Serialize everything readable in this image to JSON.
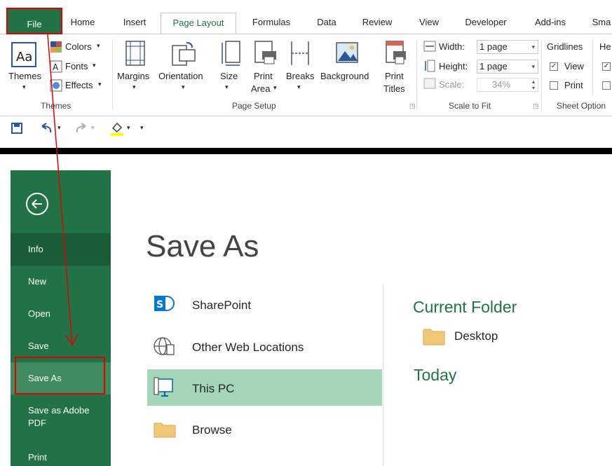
{
  "ribbon_tabs": {
    "file": "File",
    "items": [
      "Home",
      "Insert",
      "Page Layout",
      "Formulas",
      "Data",
      "Review",
      "View",
      "Developer",
      "Add-ins",
      "Sma"
    ],
    "active": "Page Layout"
  },
  "themes_group": {
    "themes_label": "Themes",
    "colors_label": "Colors",
    "fonts_label": "Fonts",
    "effects_label": "Effects",
    "group_label": "Themes"
  },
  "page_setup_group": {
    "margins": "Margins",
    "orientation": "Orientation",
    "size": "Size",
    "print_area_1": "Print",
    "print_area_2": "Area",
    "breaks": "Breaks",
    "background": "Background",
    "print_titles_1": "Print",
    "print_titles_2": "Titles",
    "group_label": "Page Setup"
  },
  "scale_group": {
    "width_label": "Width:",
    "width_value": "1 page",
    "height_label": "Height:",
    "height_value": "1 page",
    "scale_label": "Scale:",
    "scale_value": "34%",
    "group_label": "Scale to Fit"
  },
  "sheet_options_group": {
    "gridlines": "Gridlines",
    "headings": "He",
    "view": "View",
    "view_checked": true,
    "print": "Print",
    "print_checked": false,
    "group_label": "Sheet Option"
  },
  "backstage": {
    "nav": [
      "Info",
      "New",
      "Open",
      "Save",
      "Save As",
      "Save as Adobe PDF",
      "Print"
    ],
    "selected_nav": "Save As",
    "title": "Save As",
    "locations": [
      "SharePoint",
      "Other Web Locations",
      "This PC",
      "Browse"
    ],
    "selected_location": "This PC",
    "current_folder_heading": "Current Folder",
    "current_folder": "Desktop",
    "today_heading": "Today"
  },
  "colors": {
    "excel_green": "#217346",
    "nav_selected": "#3f8a5f",
    "location_selected": "#a3d6b8",
    "annotation_red": "#e00000",
    "folder_yellow": "#f0c878"
  }
}
